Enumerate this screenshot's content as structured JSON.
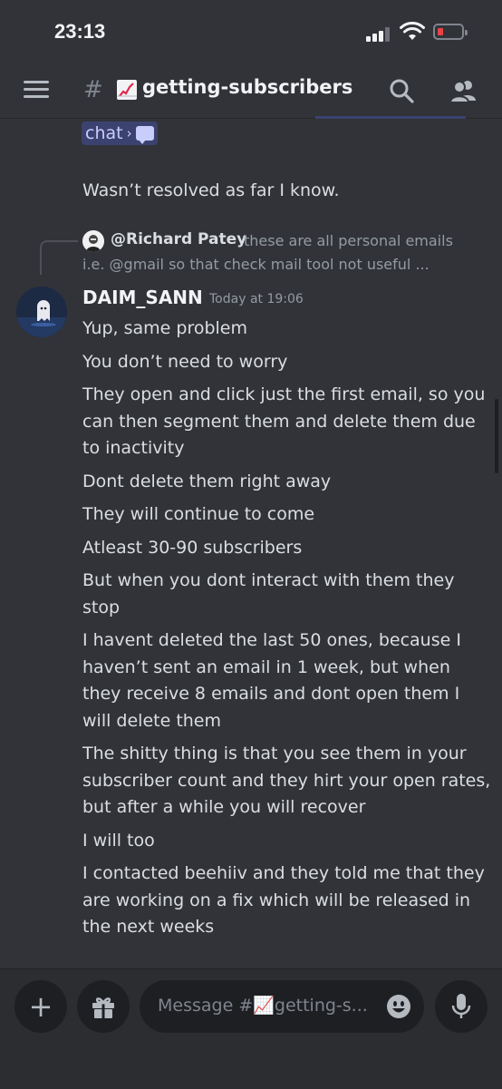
{
  "status_bar": {
    "time": "23:13"
  },
  "header": {
    "channel_hash": "#",
    "channel_name": "getting-subscribers",
    "channel_emoji": "chart-increasing-icon"
  },
  "thread_chip": {
    "label": "chat",
    "chevron": "›"
  },
  "prev_message": "Wasn’t resolved as far I know.",
  "reply_preview": {
    "author": "@Richard Patey",
    "text": "these are all personal emails",
    "text_cont": "i.e. @gmail so that check mail tool not useful ..."
  },
  "message": {
    "author": "DAIM_SANN",
    "timestamp": "Today at 19:06",
    "lines": [
      "Yup, same problem",
      "You don’t need to worry",
      "They open and click just the first email, so you can then segment them and delete them due to inactivity",
      "Dont delete them right away",
      "They will continue to come",
      "Atleast 30-90 subscribers",
      "But when you dont interact with them they stop",
      "I havent deleted the last 50 ones, because I haven’t sent an email in 1 week, but when they receive 8 emails and dont open them I will delete them",
      "The shitty thing is that you see them in your subscriber count and they hirt your open rates, but after a while you will recover",
      "I will too",
      "I contacted beehiiv and they told me that they are working on a fix which will be released in the next weeks"
    ]
  },
  "composer": {
    "placeholder": "Message #📈getting-s..."
  },
  "colors": {
    "background": "#313338",
    "composer_bg": "#2b2d31",
    "mention_bg": "#3c4270",
    "battery_low": "#ed4245"
  }
}
